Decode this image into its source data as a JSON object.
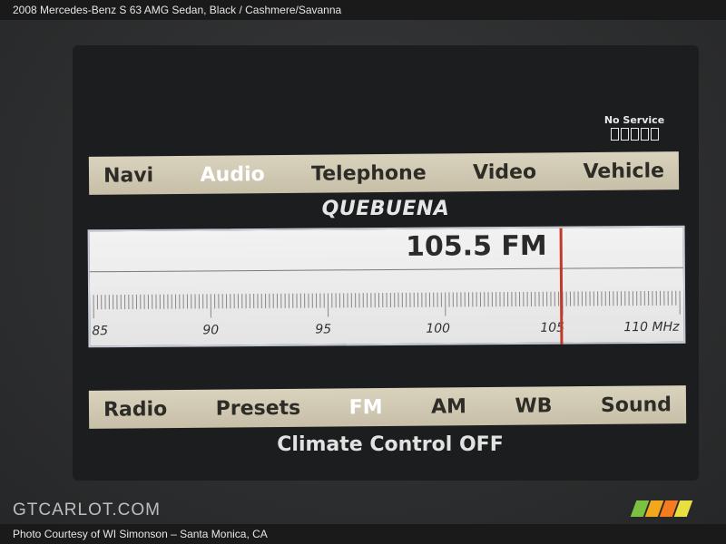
{
  "caption": "2008 Mercedes-Benz S 63 AMG Sedan,  Black / Cashmere/Savanna",
  "status": {
    "no_service": "No Service"
  },
  "top_nav": [
    {
      "label": "Navi",
      "active": false
    },
    {
      "label": "Audio",
      "active": true
    },
    {
      "label": "Telephone",
      "active": false
    },
    {
      "label": "Video",
      "active": false
    },
    {
      "label": "Vehicle",
      "active": false
    }
  ],
  "station_name": "QUEBUENA",
  "tuner": {
    "frequency": "105.5 FM",
    "scale_labels": [
      "85",
      "90",
      "95",
      "100",
      "105",
      "110 MHz"
    ],
    "needle_color": "#c0392b"
  },
  "bottom_nav": [
    {
      "label": "Radio",
      "active": false
    },
    {
      "label": "Presets",
      "active": false
    },
    {
      "label": "FM",
      "active": true
    },
    {
      "label": "AM",
      "active": false
    },
    {
      "label": "WB",
      "active": false
    },
    {
      "label": "Sound",
      "active": false
    }
  ],
  "climate_status": "Climate Control OFF",
  "watermark": "GTCARLOT.COM",
  "logo_colors": [
    "#7cc242",
    "#f2a81d",
    "#f47b20",
    "#e8e040"
  ],
  "photo_credit": "Photo Courtesy of WI Simonson – Santa Monica, CA"
}
